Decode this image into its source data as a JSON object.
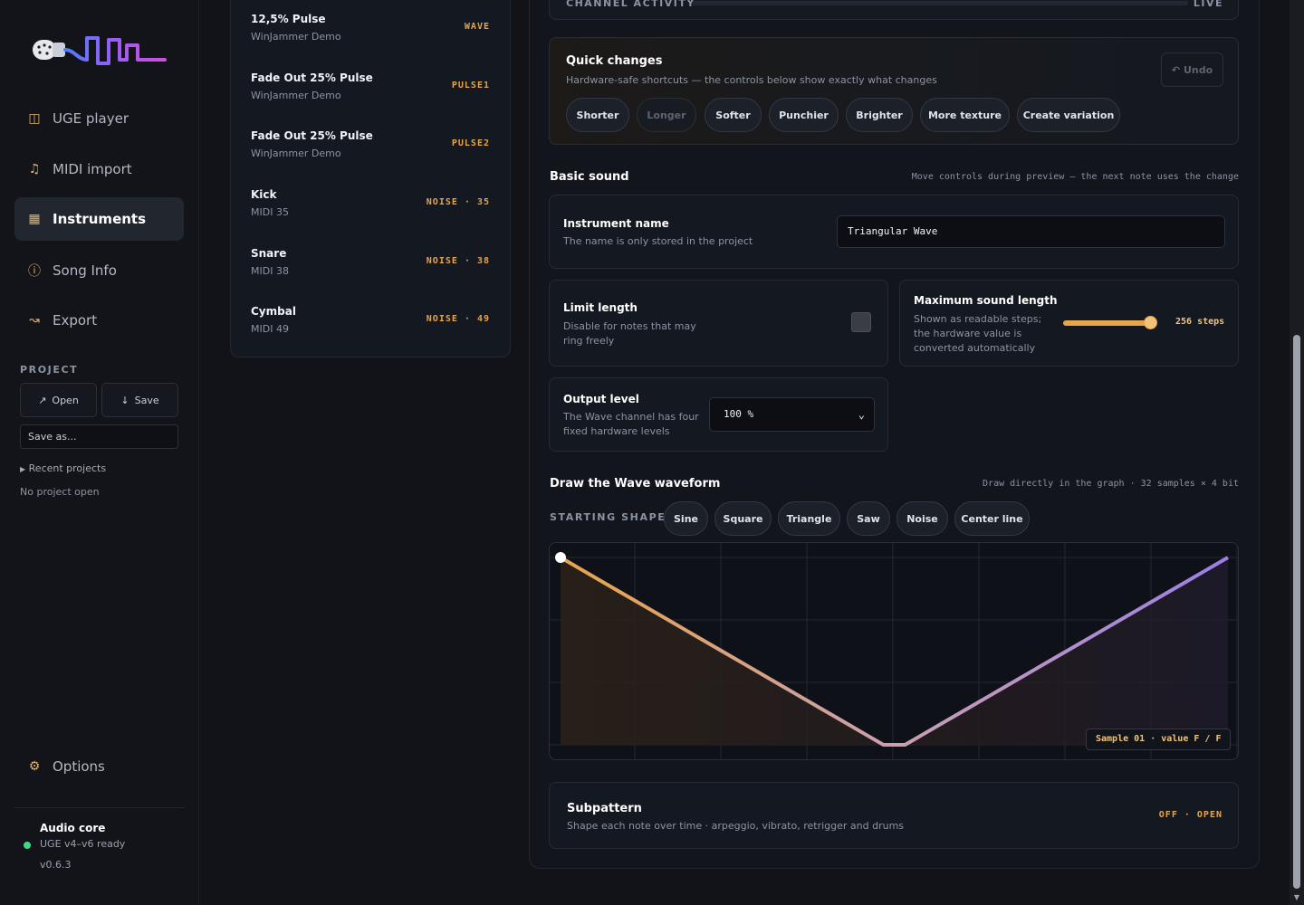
{
  "sidebar": {
    "nav": [
      {
        "label": "UGE player",
        "icon": "panels-icon"
      },
      {
        "label": "MIDI import",
        "icon": "music-note-icon"
      },
      {
        "label": "Instruments",
        "icon": "grid-icon",
        "active": true
      },
      {
        "label": "Song Info",
        "icon": "info-circle-icon"
      },
      {
        "label": "Export",
        "icon": "export-icon"
      }
    ],
    "project_label": "PROJECT",
    "open_label": "Open",
    "save_label": "Save",
    "save_as_label": "Save as...",
    "recent_label": "Recent projects",
    "no_project": "No project open",
    "options_label": "Options",
    "audio": {
      "title": "Audio core",
      "status": "UGE v4–v6 ready",
      "version": "v0.6.3",
      "status_color": "#3ddc84"
    }
  },
  "instruments": [
    {
      "name": "12,5% Pulse",
      "source": "WinJammer Demo",
      "tag": "WAVE"
    },
    {
      "name": "Fade Out 25% Pulse",
      "source": "WinJammer Demo",
      "tag": "PULSE1"
    },
    {
      "name": "Fade Out 25% Pulse",
      "source": "WinJammer Demo",
      "tag": "PULSE2"
    },
    {
      "name": "Kick",
      "source": "MIDI 35",
      "tag": "NOISE · 35"
    },
    {
      "name": "Snare",
      "source": "MIDI 38",
      "tag": "NOISE · 38"
    },
    {
      "name": "Cymbal",
      "source": "MIDI 49",
      "tag": "NOISE · 49"
    }
  ],
  "activity": {
    "label": "CHANNEL ACTIVITY",
    "live": "LIVE"
  },
  "quick": {
    "title": "Quick changes",
    "subtitle": "Hardware-safe shortcuts — the controls below show exactly what changes",
    "undo_label": "Undo",
    "chips": [
      "Shorter",
      "Longer",
      "Softer",
      "Punchier",
      "Brighter",
      "More texture",
      "Create variation"
    ]
  },
  "basic": {
    "title": "Basic sound",
    "hint": "Move controls during preview — the next note uses the change",
    "name_title": "Instrument name",
    "name_desc": "The name is only stored in the project",
    "name_value": "Triangular Wave",
    "limit_title": "Limit length",
    "limit_desc": "Disable for notes that may ring freely",
    "limit_checked": false,
    "max_title": "Maximum sound length",
    "max_desc": "Shown as readable steps; the hardware value is converted automatically",
    "max_value": "256 steps",
    "max_fraction": 1.0,
    "level_title": "Output level",
    "level_desc": "The Wave channel has four fixed hardware levels",
    "level_value": "100 %"
  },
  "wave": {
    "title": "Draw the Wave waveform",
    "hint": "Draw directly in the graph · 32 samples × 4 bit",
    "shape_label": "STARTING SHAPE",
    "shapes": [
      "Sine",
      "Square",
      "Triangle",
      "Saw",
      "Noise",
      "Center line"
    ],
    "samples": [
      15,
      14,
      13,
      12,
      11,
      10,
      9,
      8,
      7,
      6,
      5,
      4,
      3,
      2,
      1,
      0,
      0,
      1,
      2,
      3,
      4,
      5,
      6,
      7,
      8,
      9,
      10,
      11,
      12,
      13,
      14,
      15
    ],
    "max_value": 15,
    "tooltip": "Sample 01 · value F / F",
    "colors": {
      "start": "#e8a44a",
      "mid": "#c9a0b0",
      "end": "#9b7ee8"
    }
  },
  "subpattern": {
    "title": "Subpattern",
    "desc": "Shape each note over time · arpeggio, vibrato, retrigger and drums",
    "state": "OFF · OPEN"
  }
}
